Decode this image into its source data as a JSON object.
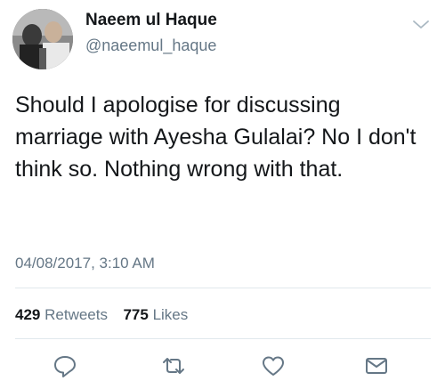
{
  "author": {
    "display_name": "Naeem ul Haque",
    "handle": "@naeemul_haque"
  },
  "tweet": {
    "text": "Should I apologise for discussing marriage with Ayesha Gulalai? No I don't think so. Nothing wrong with that.",
    "timestamp": "04/08/2017, 3:10 AM"
  },
  "stats": {
    "retweets_count": "429",
    "retweets_label": "Retweets",
    "likes_count": "775",
    "likes_label": "Likes"
  },
  "icons": {
    "menu": "chevron-down-icon",
    "reply": "reply-icon",
    "retweet": "retweet-icon",
    "like": "heart-icon",
    "message": "envelope-icon"
  },
  "colors": {
    "text": "#14171a",
    "secondary": "#657786",
    "divider": "#e1e8ed"
  }
}
